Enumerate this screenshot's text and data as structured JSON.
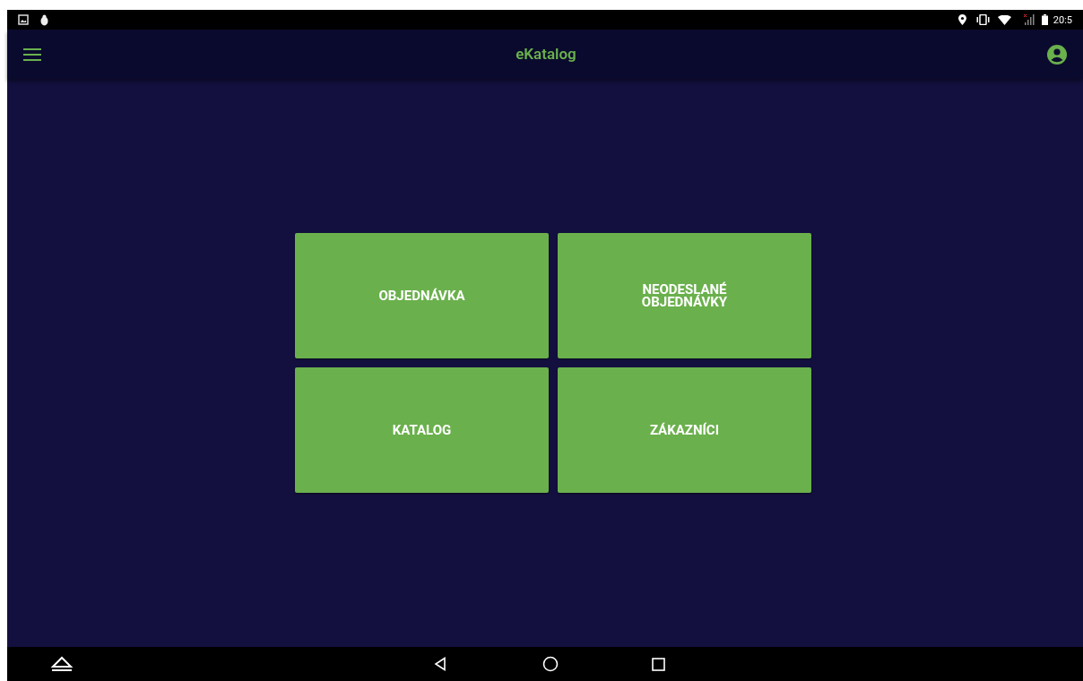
{
  "status_bar": {
    "time": "20:5"
  },
  "app_bar": {
    "title": "eKatalog"
  },
  "tiles": [
    {
      "label": "OBJEDNÁVKA"
    },
    {
      "label": "NEODESLANÉ OBJEDNÁVKY"
    },
    {
      "label": "KATALOG"
    },
    {
      "label": "ZÁKAZNÍCI"
    }
  ]
}
